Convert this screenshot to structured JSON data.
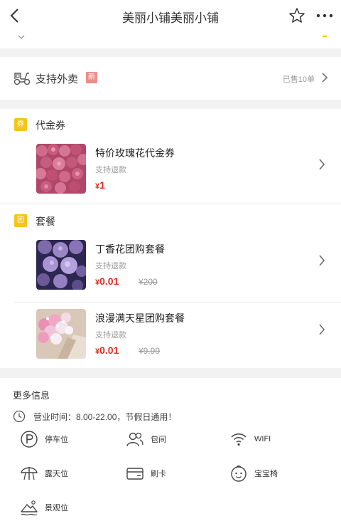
{
  "header": {
    "title": "美丽小铺美丽小铺"
  },
  "delivery": {
    "label": "支持外卖",
    "new_badge": "新",
    "sold": "已售10单"
  },
  "voucher_section": {
    "title": "代金券",
    "icon_char": "券",
    "items": [
      {
        "name": "特价玫瑰花代金券",
        "refund": "支持退款",
        "currency": "¥",
        "price": "1"
      }
    ]
  },
  "package_section": {
    "title": "套餐",
    "icon_char": "团",
    "items": [
      {
        "name": "丁香花团购套餐",
        "refund": "支持退款",
        "currency": "¥",
        "price": "0.01",
        "original": "¥200"
      },
      {
        "name": "浪漫满天星团购套餐",
        "refund": "支持退款",
        "currency": "¥",
        "price": "0.01",
        "original": "¥9.99"
      }
    ]
  },
  "more_info": {
    "heading": "更多信息",
    "hours": "营业时间：8.00-22.00，节假日通用！",
    "facilities": {
      "parking": "停车位",
      "private_room": "包间",
      "wifi": "WIFI",
      "outdoor": "露天位",
      "card": "刷卡",
      "baby_chair": "宝宝椅",
      "scenic": "景观位"
    }
  },
  "colors": {
    "accent_yellow": "#f5c518",
    "price_red": "#e8281f",
    "badge_pink": "#f08c8c"
  }
}
